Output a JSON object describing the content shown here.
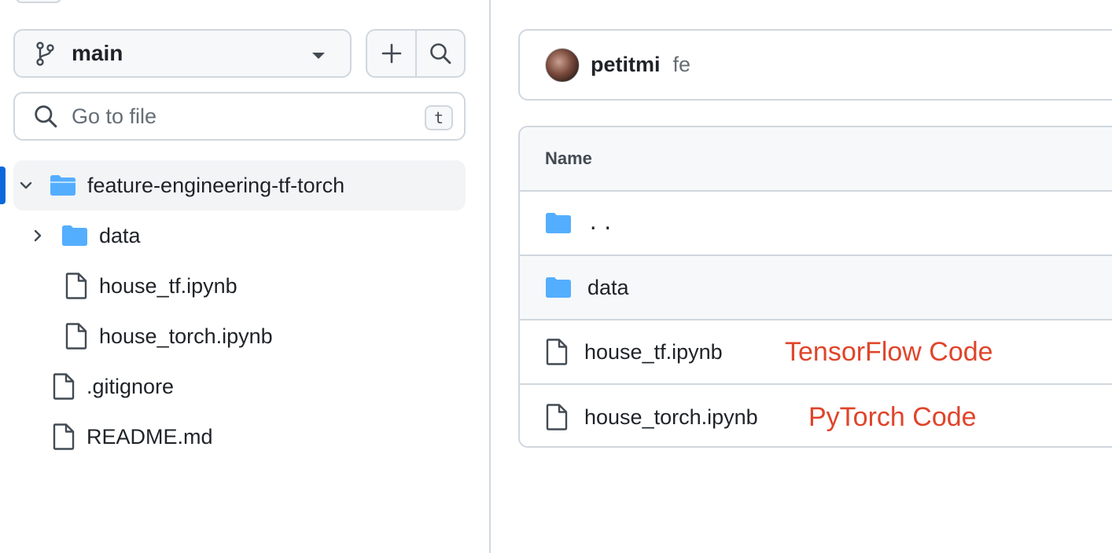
{
  "branch": {
    "name": "main"
  },
  "toolbar": {
    "add_icon": "plus-icon",
    "search_icon": "search-icon"
  },
  "search": {
    "placeholder": "Go to file",
    "shortcut": "t"
  },
  "tree": {
    "root": {
      "label": "feature-engineering-tf-torch",
      "expanded": true,
      "selected": true
    },
    "children": [
      {
        "label": "data",
        "type": "folder",
        "expanded": false
      },
      {
        "label": "house_tf.ipynb",
        "type": "file"
      },
      {
        "label": "house_torch.ipynb",
        "type": "file"
      }
    ],
    "siblings": [
      {
        "label": ".gitignore",
        "type": "file"
      },
      {
        "label": "README.md",
        "type": "file"
      }
    ]
  },
  "commit": {
    "user": "petitmi",
    "message": "fe"
  },
  "table": {
    "header": "Name",
    "rows": [
      {
        "name": "..",
        "type": "folder",
        "annotation": ""
      },
      {
        "name": "data",
        "type": "folder",
        "annotation": ""
      },
      {
        "name": "house_tf.ipynb",
        "type": "file",
        "annotation": "TensorFlow Code"
      },
      {
        "name": "house_torch.ipynb",
        "type": "file",
        "annotation": "PyTorch Code"
      }
    ]
  },
  "colors": {
    "accent": "#0969da",
    "folder": "#54aeff",
    "annotation": "#e0442a",
    "border": "#d0d7de"
  }
}
